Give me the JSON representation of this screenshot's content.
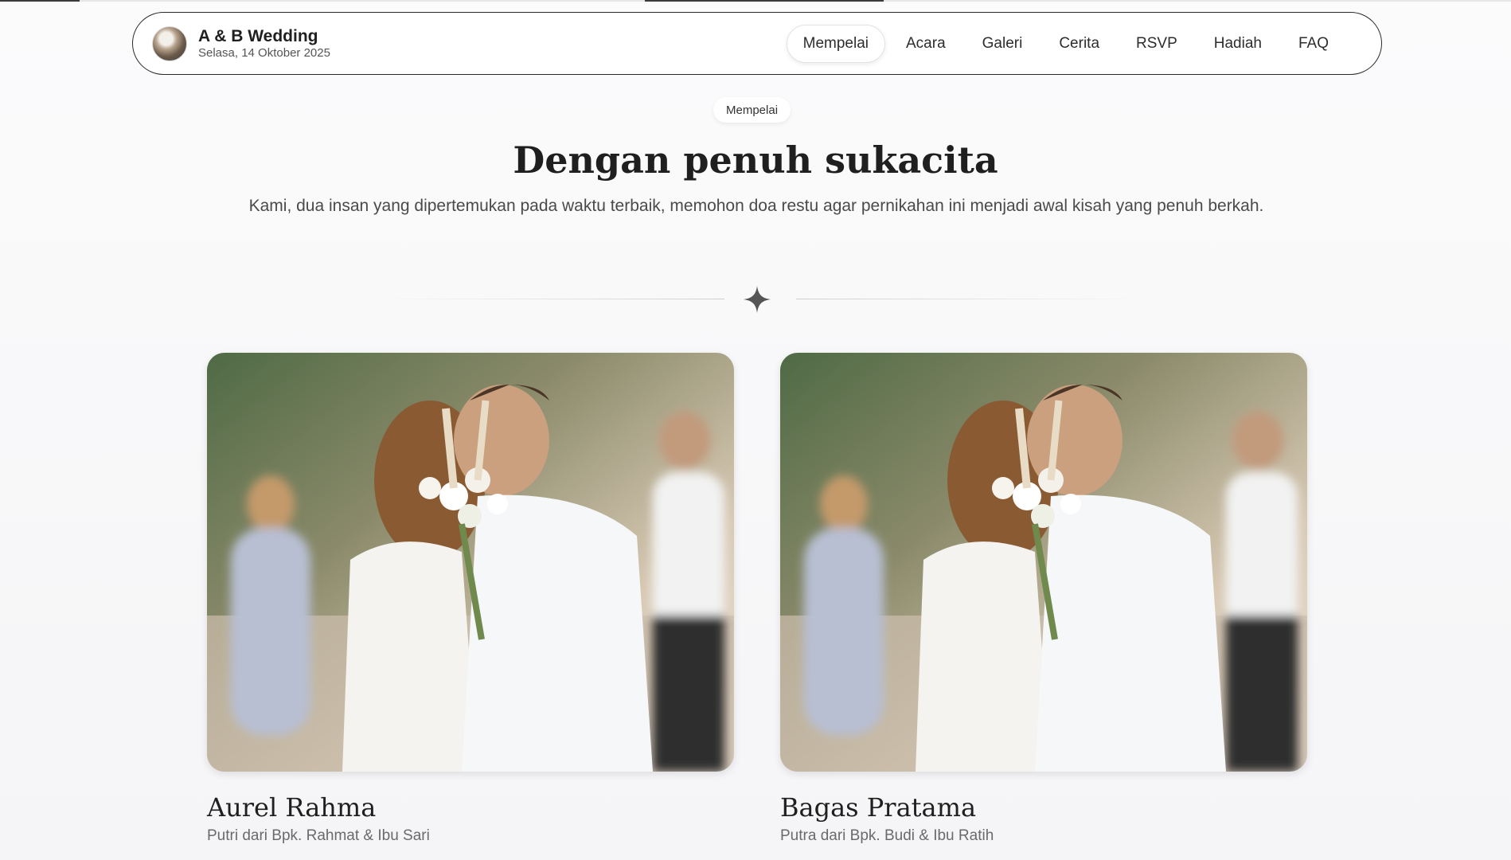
{
  "brand": {
    "title": "A & B Wedding",
    "date": "Selasa, 14 Oktober 2025"
  },
  "nav": {
    "items": [
      "Mempelai",
      "Acara",
      "Galeri",
      "Cerita",
      "RSVP",
      "Hadiah",
      "FAQ"
    ],
    "active": "Mempelai"
  },
  "section": {
    "pill": "Mempelai",
    "title": "Dengan penuh sukacita",
    "subtitle": "Kami, dua insan yang dipertemukan pada waktu terbaik, memohon doa restu agar pernikahan ini menjadi awal kisah yang penuh berkah."
  },
  "couple": [
    {
      "name": "Aurel Rahma",
      "parents": "Putri dari Bpk. Rahmat & Ibu Sari"
    },
    {
      "name": "Bagas Pratama",
      "parents": "Putra dari Bpk. Budi & Ibu Ratih"
    }
  ],
  "colors": {
    "accent": "#2a2a2a",
    "background": "#f7f7f8",
    "star": "#555555"
  }
}
